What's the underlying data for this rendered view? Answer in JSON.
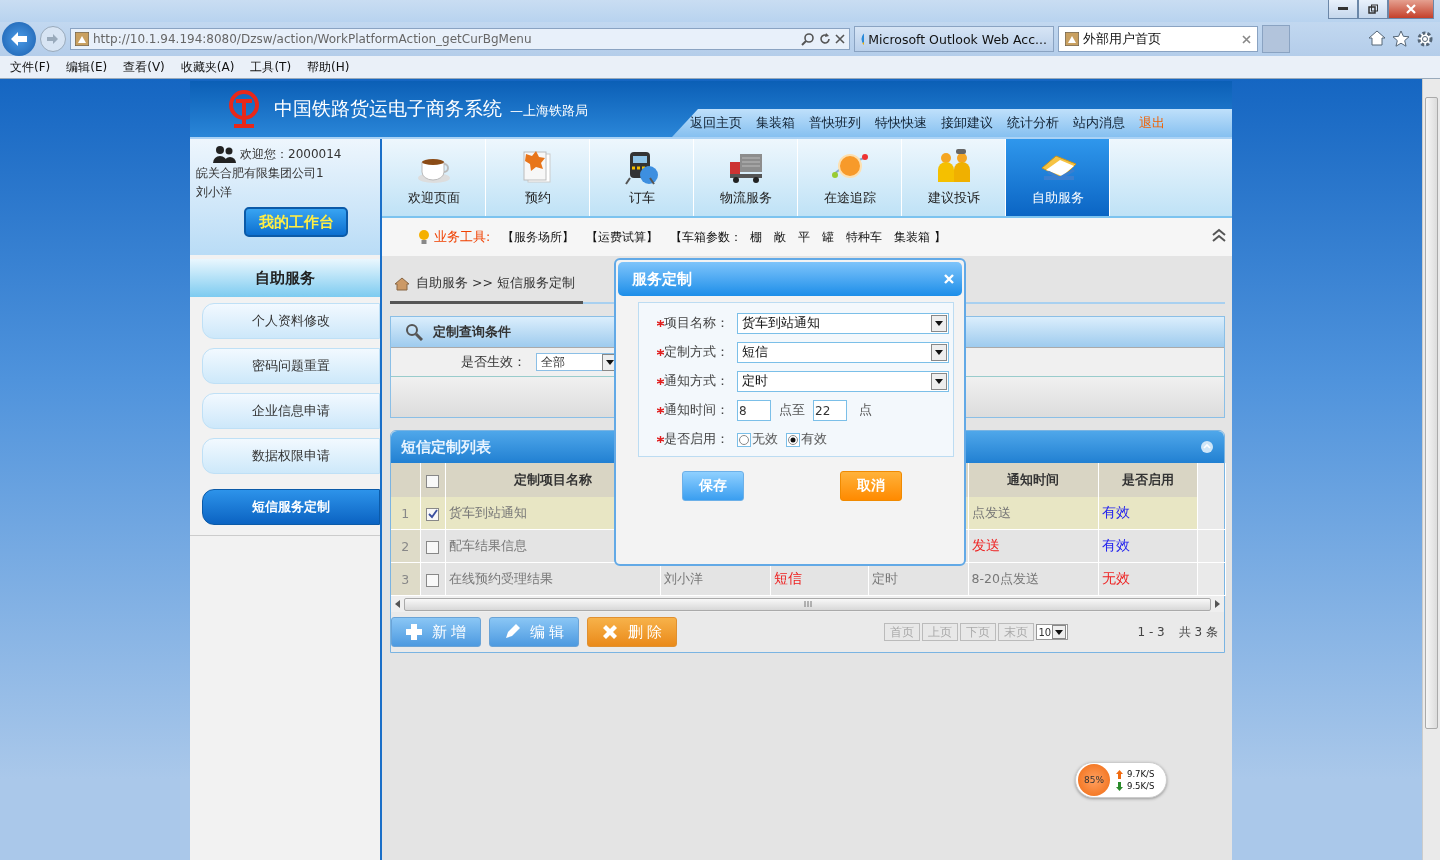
{
  "browser": {
    "address": "http://10.1.94.194:8080/Dzsw/action/WorkPlatformAction_getCurBgMenu",
    "tabs": [
      {
        "label": "Microsoft Outlook Web Acc...",
        "selected": false
      },
      {
        "label": "外部用户首页",
        "selected": true
      }
    ],
    "menu": [
      "文件(F)",
      "编辑(E)",
      "查看(V)",
      "收藏夹(A)",
      "工具(T)",
      "帮助(H)"
    ]
  },
  "header": {
    "title": "中国铁路货运电子商务系统",
    "subtitle": "—上海铁路局",
    "nav": [
      {
        "label": "返回主页",
        "kind": "link"
      },
      {
        "label": "集装箱",
        "kind": "link"
      },
      {
        "label": "普快班列",
        "kind": "link"
      },
      {
        "label": "特快快速",
        "kind": "link"
      },
      {
        "label": "接卸建议",
        "kind": "link"
      },
      {
        "label": "统计分析",
        "kind": "link"
      },
      {
        "label": "站内消息",
        "kind": "link"
      },
      {
        "label": "退出",
        "kind": "exit"
      }
    ]
  },
  "user": {
    "greeting": "欢迎您：2000014",
    "company": "皖关合肥有限集团公司1",
    "name": "刘小洋",
    "workbench": "我的工作台"
  },
  "sidebar": {
    "title": "自助服务",
    "items": [
      {
        "label": "个人资料修改",
        "selected": false
      },
      {
        "label": "密码问题重置",
        "selected": false
      },
      {
        "label": "企业信息申请",
        "selected": false
      },
      {
        "label": "数据权限申请",
        "selected": false
      },
      {
        "label": "短信服务定制",
        "selected": true
      }
    ]
  },
  "modules": [
    {
      "label": "欢迎页面",
      "selected": false
    },
    {
      "label": "预约",
      "selected": false
    },
    {
      "label": "订车",
      "selected": false
    },
    {
      "label": "物流服务",
      "selected": false
    },
    {
      "label": "在途追踪",
      "selected": false
    },
    {
      "label": "建议投诉",
      "selected": false
    },
    {
      "label": "自助服务",
      "selected": true
    }
  ],
  "tools": {
    "label": "业务工具:",
    "items": [
      "【服务场所】",
      "【运费试算】"
    ],
    "params_label": "【车箱参数：",
    "params": [
      "棚",
      "敞",
      "平",
      "罐",
      "特种车",
      "集装箱"
    ],
    "params_end": "】"
  },
  "breadcrumb": "自助服务 >> 短信服务定制",
  "query": {
    "title": "定制查询条件",
    "label": "是否生效：",
    "value": "全部"
  },
  "list": {
    "title": "短信定制列表",
    "select_all": {
      "checked": false
    },
    "columns": [
      "定制项目名称",
      "",
      "",
      "",
      "通知时间",
      "是否启用"
    ],
    "rows": [
      {
        "index": "1",
        "checked": true,
        "selected": true,
        "cells": [
          {
            "text": "货车到站通知"
          },
          null,
          null,
          null,
          {
            "text": "点发送"
          },
          {
            "text": "有效",
            "color": "#2222ee"
          }
        ]
      },
      {
        "index": "2",
        "checked": false,
        "selected": false,
        "cells": [
          {
            "text": "配车结果信息"
          },
          null,
          null,
          null,
          {
            "text": "发送",
            "color": "#ee2222"
          },
          {
            "text": "有效",
            "color": "#2222ee"
          }
        ]
      },
      {
        "index": "3",
        "checked": false,
        "selected": false,
        "cells": [
          {
            "text": "在线预约受理结果"
          },
          {
            "text": "刘小洋"
          },
          {
            "text": "短信",
            "color": "#ee2222"
          },
          {
            "text": "定时"
          },
          {
            "text": "8-20点发送"
          },
          {
            "text": "无效",
            "color": "#ee2222"
          }
        ]
      }
    ],
    "buttons": [
      {
        "label": "新 增",
        "kind": "add"
      },
      {
        "label": "编 辑",
        "kind": "edit"
      },
      {
        "label": "删 除",
        "kind": "delete"
      }
    ],
    "pager": {
      "buttons": [
        {
          "label": "首页",
          "disabled": true
        },
        {
          "label": "上页",
          "disabled": true
        },
        {
          "label": "下页",
          "disabled": true
        },
        {
          "label": "末页",
          "disabled": true
        }
      ],
      "page_size": "10",
      "range": "1 - 3",
      "total": "共 3 条"
    }
  },
  "dialog": {
    "title": "服务定制",
    "fields": [
      {
        "kind": "select",
        "required": true,
        "label": "项目名称：",
        "value": "货车到站通知"
      },
      {
        "kind": "select",
        "required": true,
        "label": "定制方式：",
        "value": "短信"
      },
      {
        "kind": "select",
        "required": true,
        "label": "通知方式：",
        "value": "定时"
      },
      {
        "kind": "range",
        "required": true,
        "label": "通知时间：",
        "from": "8",
        "mid": "点至",
        "to": "22",
        "end": "点"
      },
      {
        "kind": "radio",
        "required": true,
        "label": "是否启用：",
        "options": [
          {
            "label": "无效",
            "selected": false
          },
          {
            "label": "有效",
            "selected": true
          }
        ]
      }
    ],
    "save": "保存",
    "cancel": "取消"
  },
  "speed": {
    "percent": "85%",
    "up": "9.7K/S",
    "down": "9.5K/S"
  }
}
